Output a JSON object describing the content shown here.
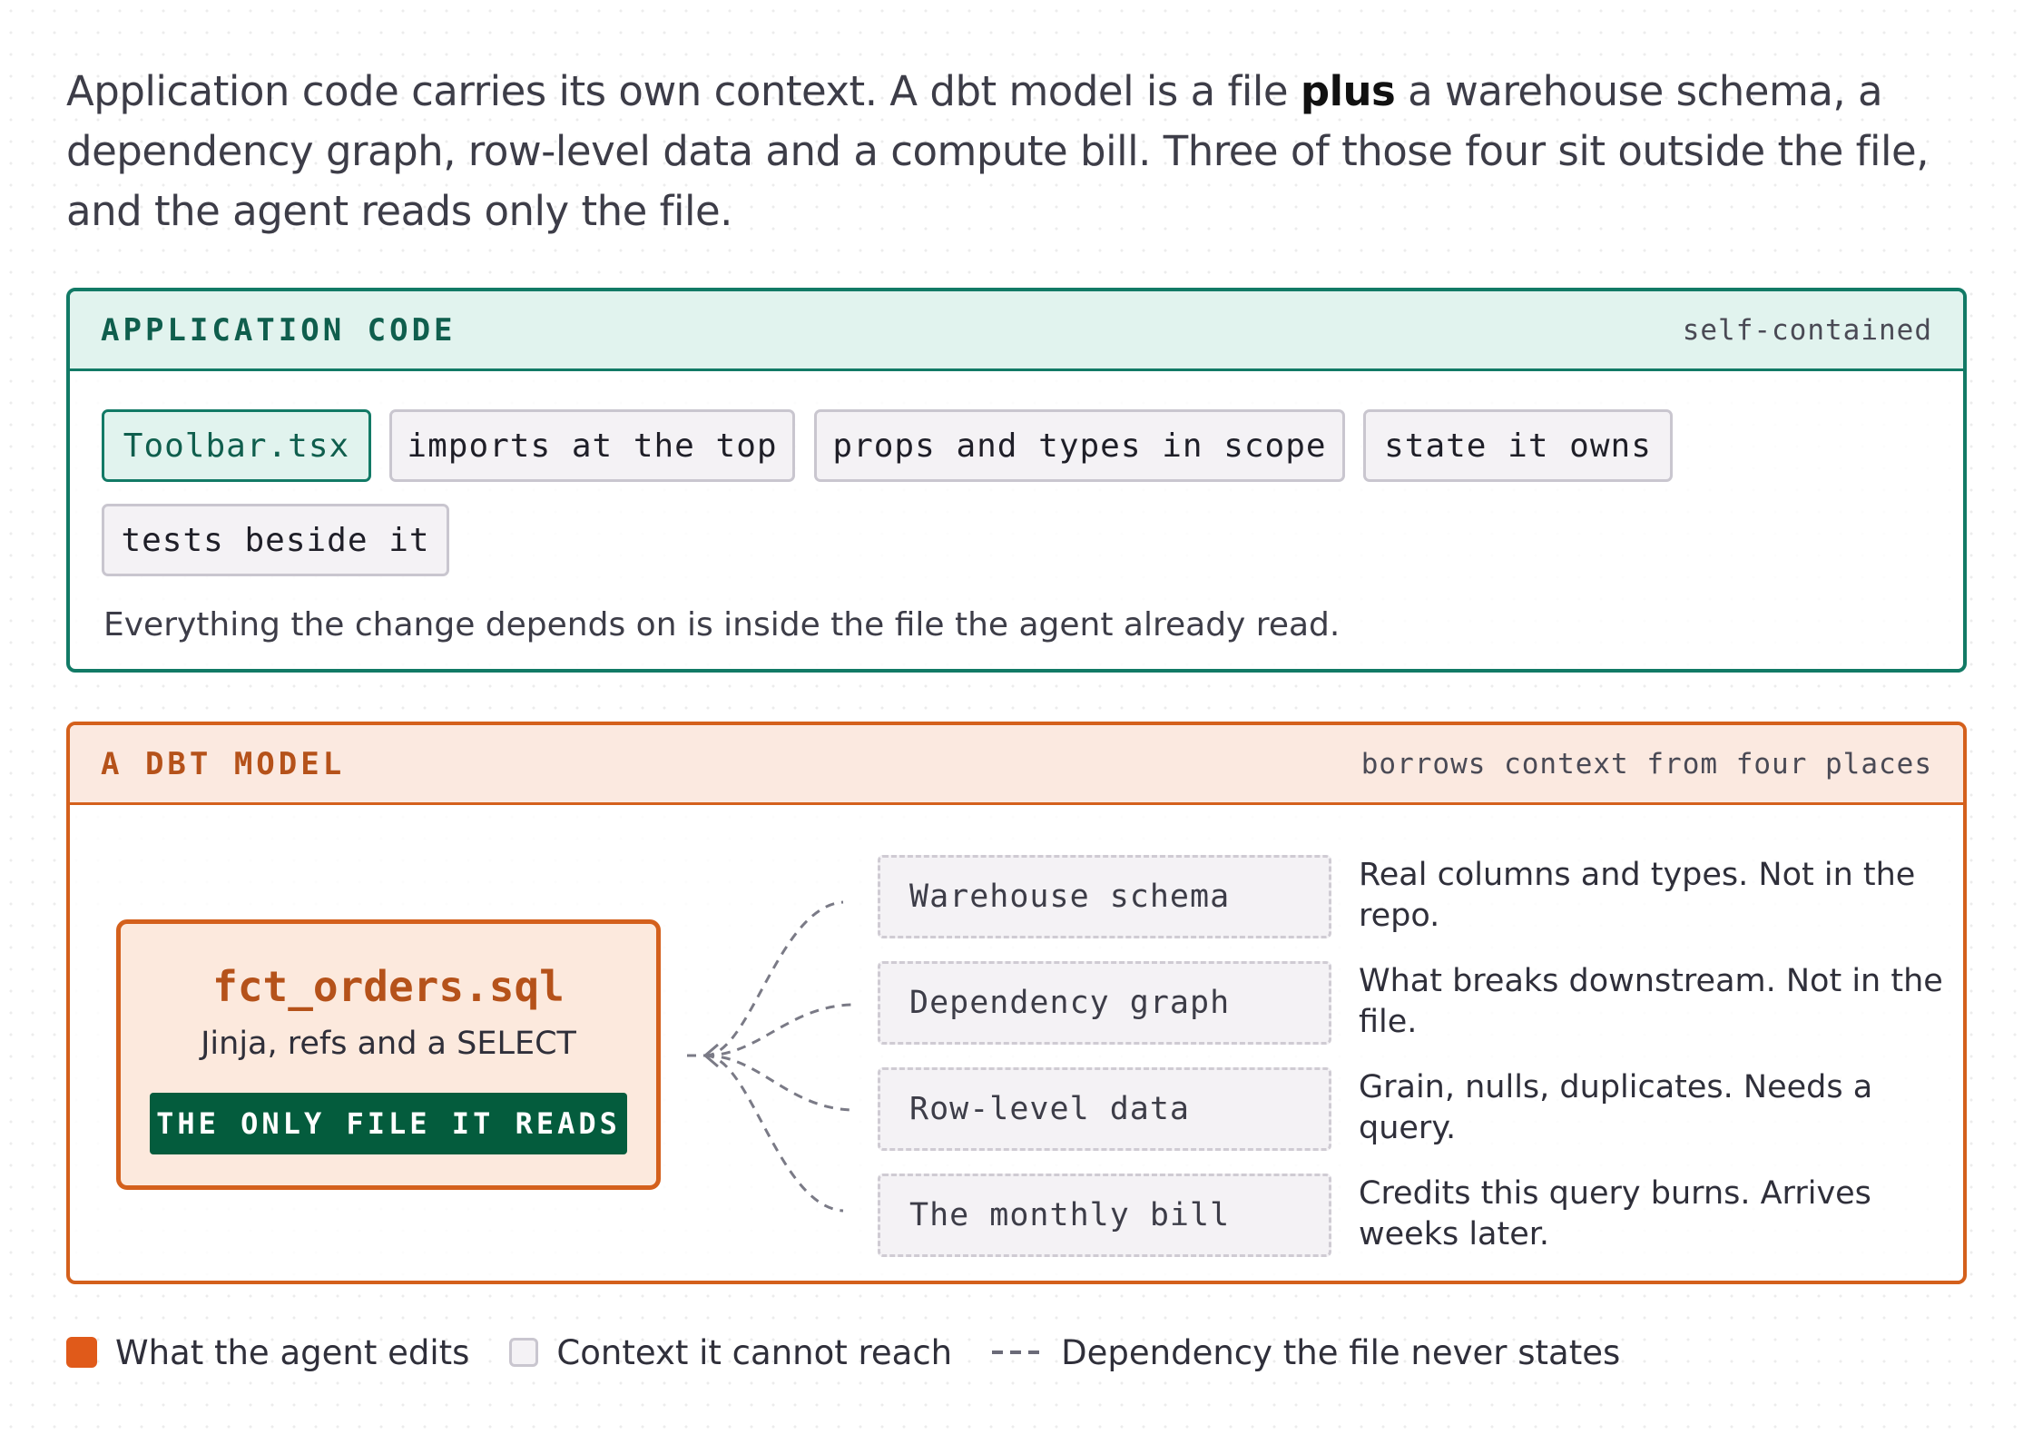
{
  "intro": {
    "text_before": "Application code carries its own context. A dbt model is a file ",
    "emphasis": "plus",
    "text_after": " a warehouse schema, a dependency graph, row-level data and a compute bill. Three of those four sit outside the file, and the agent reads only the file."
  },
  "app_panel": {
    "title": "APPLICATION CODE",
    "note": "self-contained",
    "chips": [
      "Toolbar.tsx",
      "imports at the top",
      "props and types in scope",
      "state it owns",
      "tests beside it"
    ],
    "footer": "Everything the change depends on is inside the file the agent already read."
  },
  "dbt_panel": {
    "title": "A DBT MODEL",
    "note": "borrows context from four places",
    "model": {
      "name": "fct_orders.sql",
      "subtitle": "Jinja, refs and a SELECT",
      "badge": "THE ONLY FILE IT READS"
    },
    "contexts": [
      {
        "label": "Warehouse schema",
        "note": "Real columns and types. Not in the repo."
      },
      {
        "label": "Dependency graph",
        "note": "What breaks downstream. Not in the file."
      },
      {
        "label": "Row-level data",
        "note": "Grain, nulls, duplicates. Needs a query."
      },
      {
        "label": "The monthly bill",
        "note": "Credits this query burns. Arrives weeks later."
      }
    ]
  },
  "legend": {
    "edits": "What the agent edits",
    "context": "Context it cannot reach",
    "dependency": "Dependency the file never states"
  },
  "colors": {
    "app_accent": "#127a66",
    "dbt_accent": "#d4601c",
    "badge": "#045c3d"
  }
}
